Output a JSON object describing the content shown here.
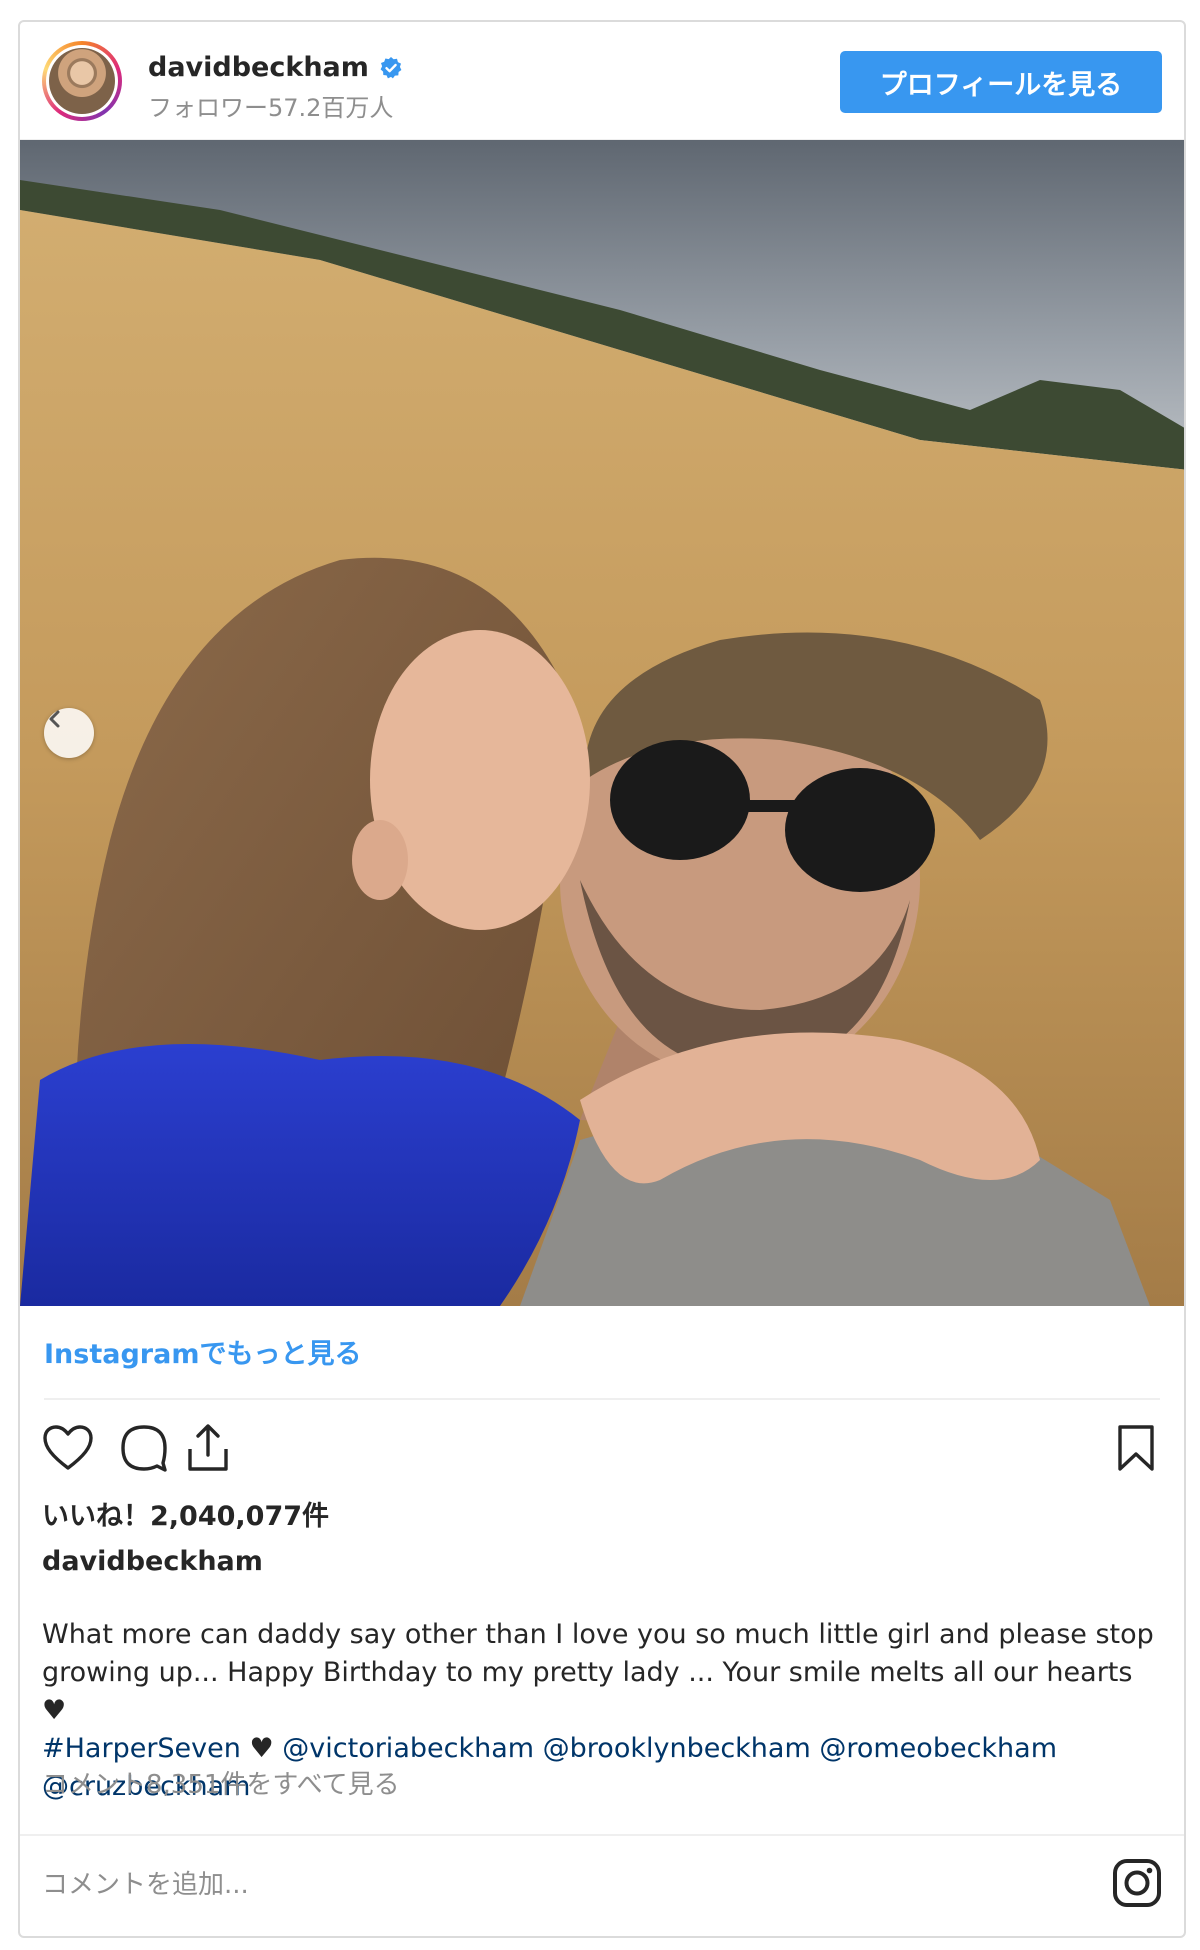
{
  "header": {
    "username": "davidbeckham",
    "followers": "フォロワー57.2百万人",
    "profile_button": "プロフィールを見る",
    "verified_icon": "verified-badge-icon",
    "accent_color": "#3897f0"
  },
  "photo": {
    "nav_prev_icon": "chevron-left-icon"
  },
  "more_link": "Instagramでもっと見る",
  "actions": {
    "icons": [
      "heart-icon",
      "comment-icon",
      "share-icon",
      "bookmark-icon"
    ]
  },
  "likes": "いいね！2,040,077件",
  "caption": {
    "username": "davidbeckham",
    "line1": "What more can daddy say other than I love you so much little girl and please stop",
    "line2": "growing up... Happy Birthday to my pretty lady ... Your smile melts all our hearts ♥",
    "hashtag": "#HarperSeven",
    "heart": "♥",
    "mention1": "@victoriabeckham",
    "mention2": "@brooklynbeckham",
    "mention3": "@romeobeckham",
    "mention4": "@cruzbeckham"
  },
  "view_comments": "コメント8,351件をすべて見る",
  "add_comment_placeholder": "コメントを追加...",
  "footer_icon": "instagram-logo-icon"
}
